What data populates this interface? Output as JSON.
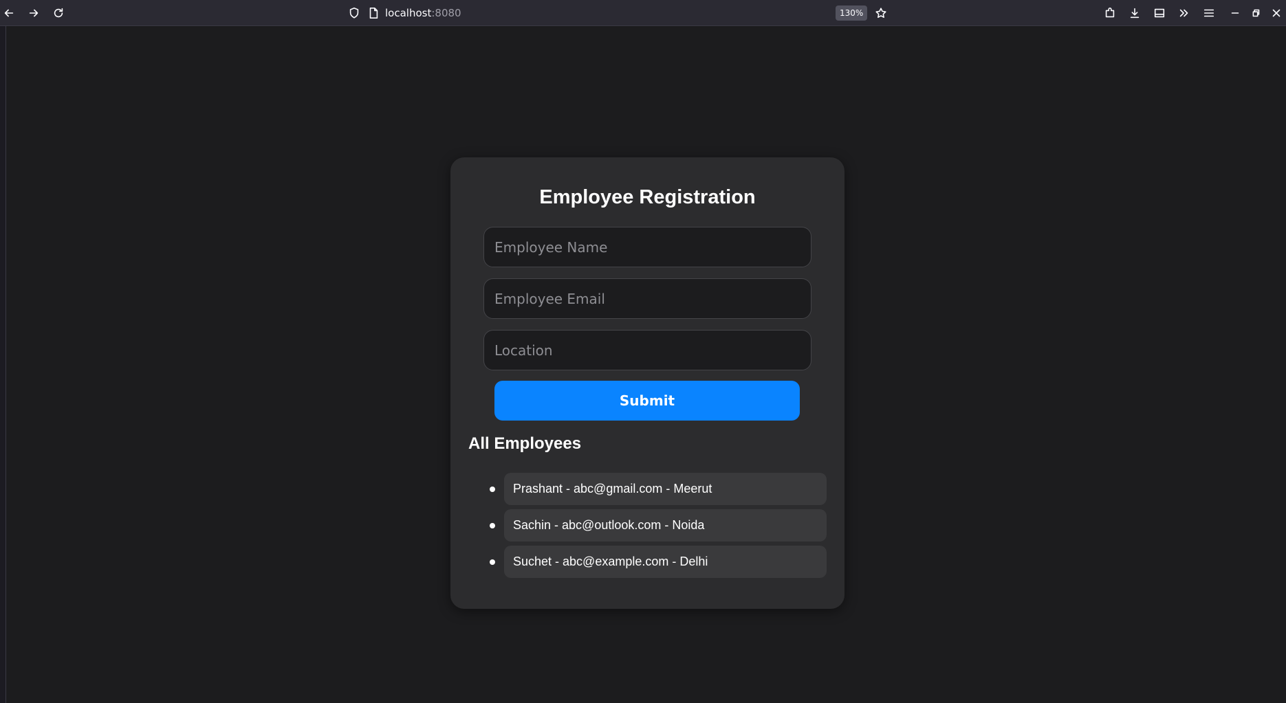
{
  "browser": {
    "url_host": "localhost",
    "url_port": ":8080",
    "zoom": "130%",
    "icons": [
      "back-arrow-icon",
      "forward-arrow-icon",
      "reload-icon",
      "shield-icon",
      "page-icon",
      "star-icon",
      "extensions-icon",
      "download-icon",
      "sidebar-icon",
      "overflow-icon",
      "menu-icon",
      "minimize-icon",
      "restore-icon",
      "close-icon"
    ]
  },
  "form": {
    "title": "Employee Registration",
    "name_placeholder": "Employee Name",
    "email_placeholder": "Employee Email",
    "location_placeholder": "Location",
    "submit_label": "Submit"
  },
  "employees": {
    "title": "All Employees",
    "items": [
      "Prashant - abc@gmail.com - Meerut",
      "Sachin - abc@outlook.com - Noida",
      "Suchet - abc@example.com - Delhi"
    ]
  },
  "colors": {
    "accent": "#0a84ff",
    "card_bg": "#2c2c2e",
    "page_bg": "#1c1c1e"
  }
}
